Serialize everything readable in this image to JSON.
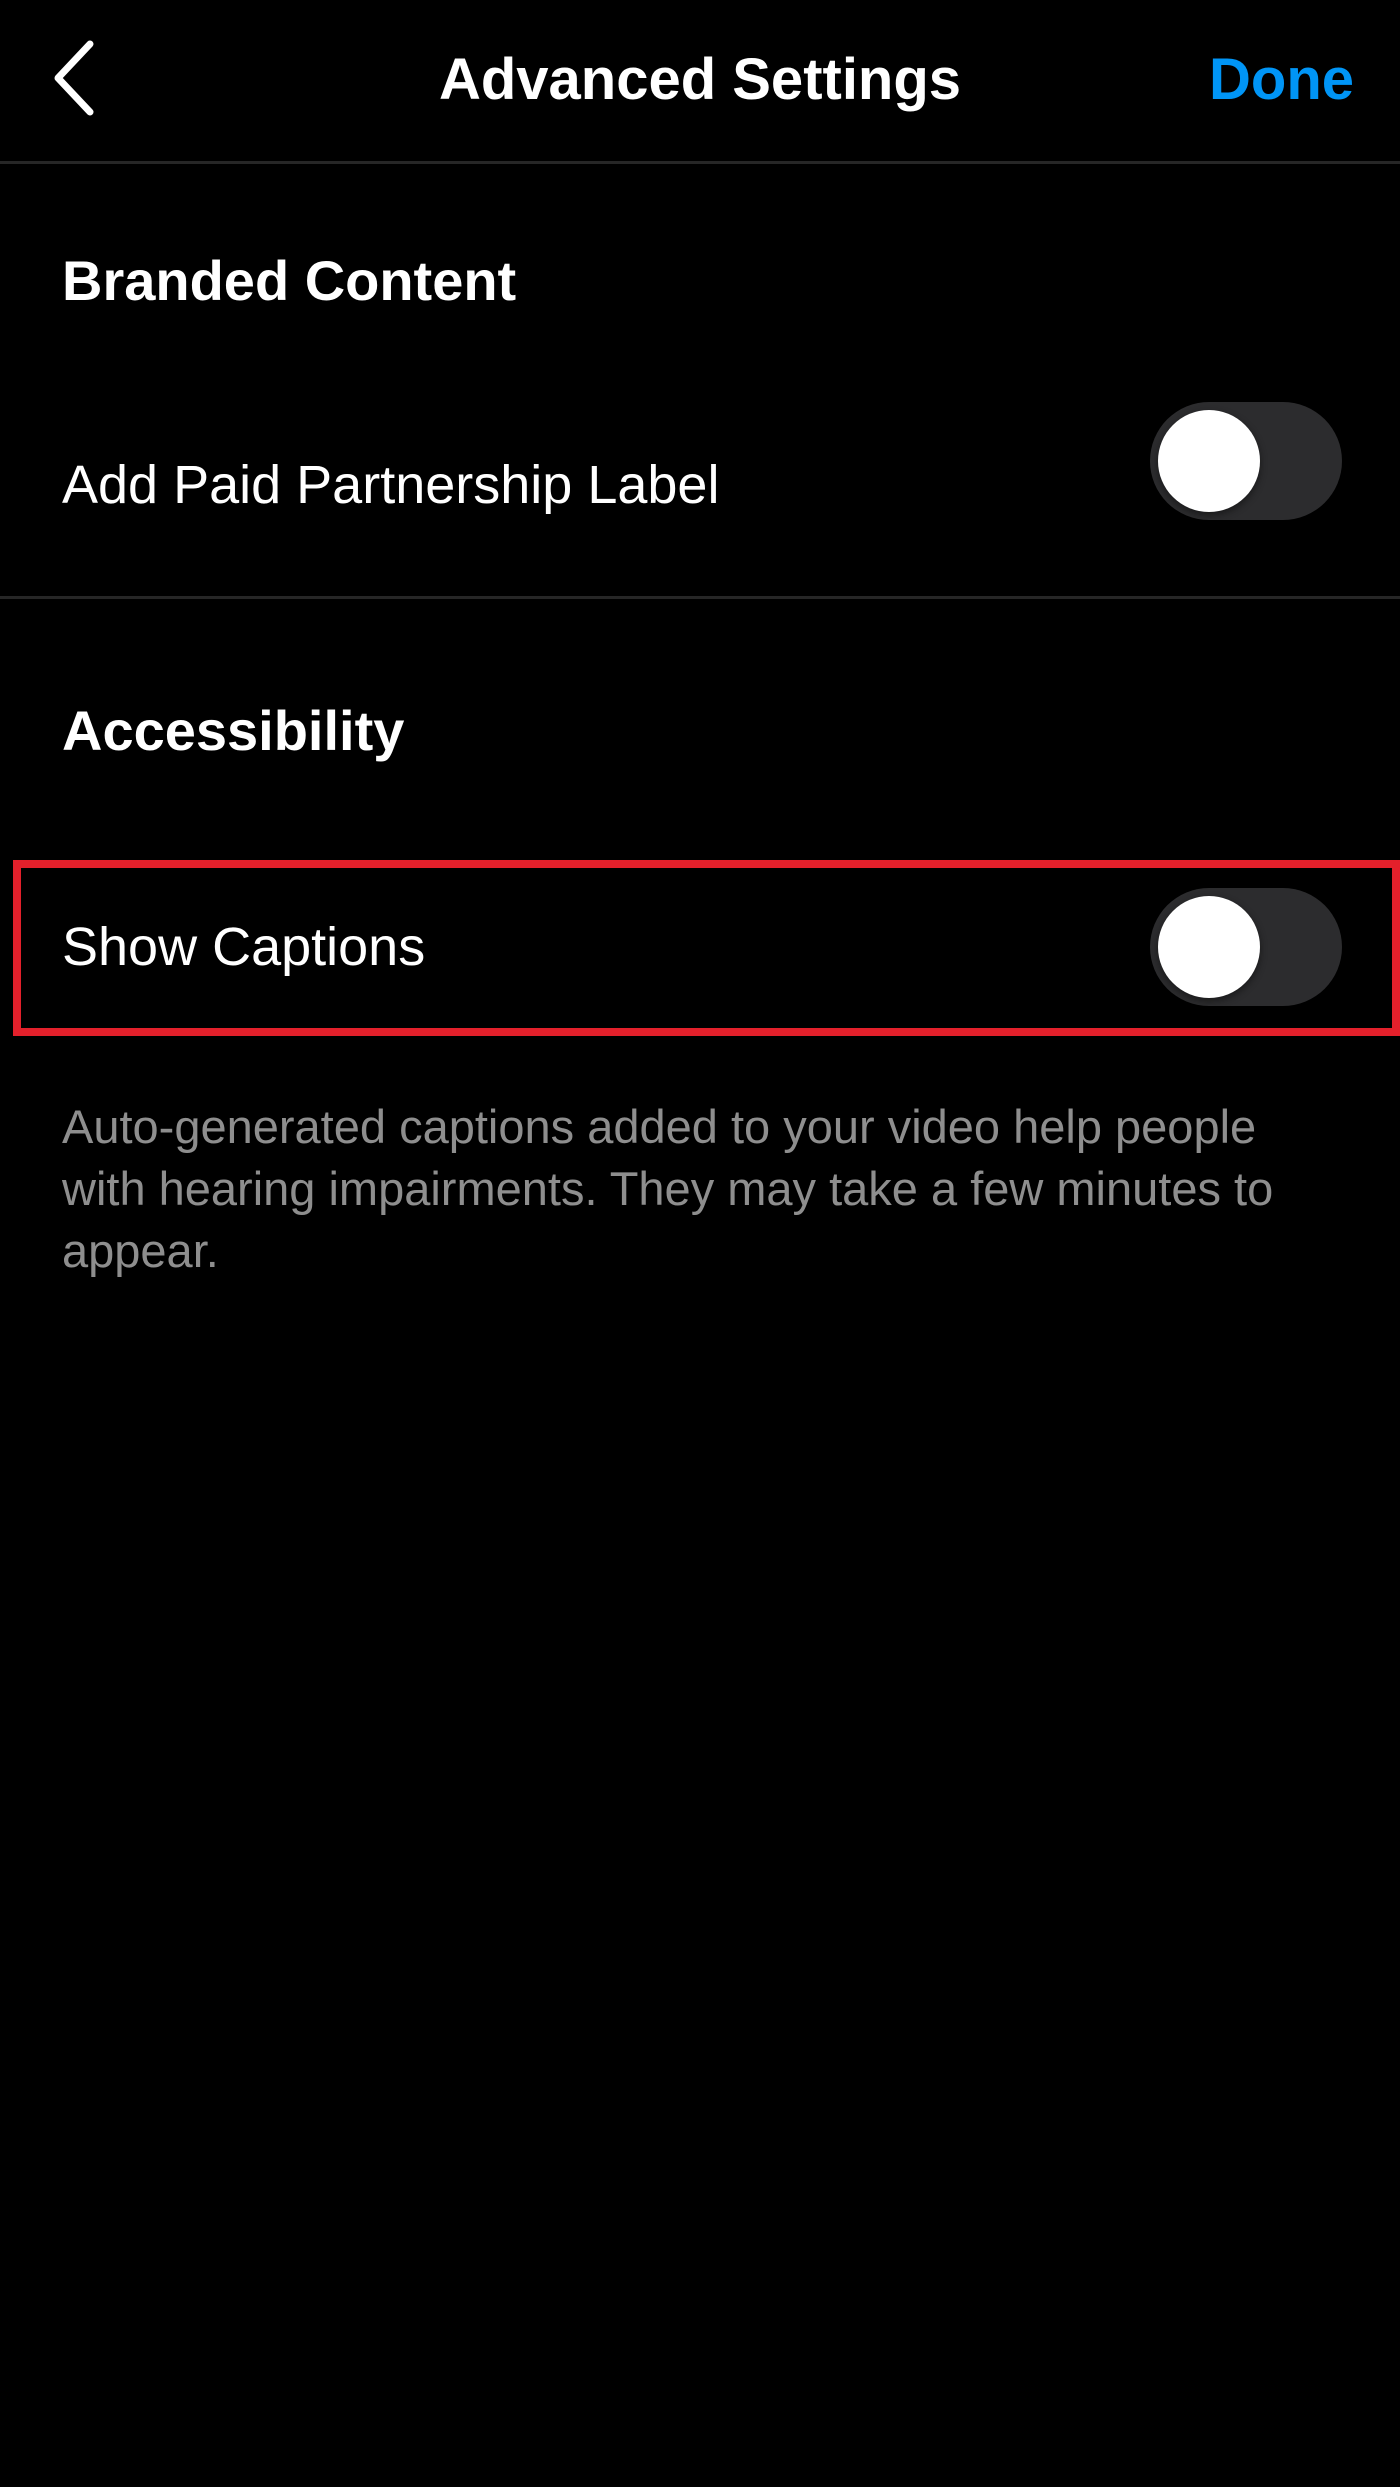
{
  "colors": {
    "background": "#000000",
    "text_primary": "#ffffff",
    "text_secondary": "#8e8e8e",
    "accent": "#0095f6",
    "divider": "#262626",
    "toggle_track_off": "#2c2c2e",
    "highlight": "#e3202b"
  },
  "nav": {
    "back_icon": "chevron-left-icon",
    "title": "Advanced Settings",
    "done_label": "Done"
  },
  "sections": {
    "branded_content": {
      "header": "Branded Content",
      "paid_partnership": {
        "label": "Add Paid Partnership Label",
        "enabled": false
      }
    },
    "accessibility": {
      "header": "Accessibility",
      "show_captions": {
        "label": "Show Captions",
        "enabled": false
      },
      "description": "Auto-generated captions added to your video help people with hearing impairments. They may take a few minutes to appear."
    }
  }
}
